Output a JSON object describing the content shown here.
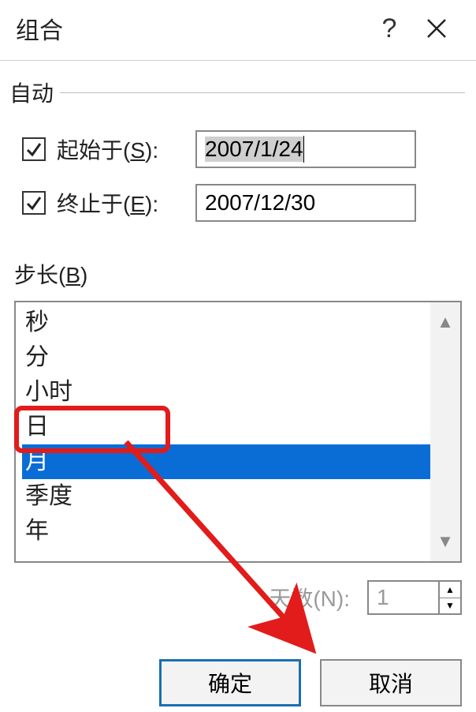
{
  "titlebar": {
    "title": "组合",
    "help": "?",
    "close_icon": "close-icon"
  },
  "auto": {
    "legend": "自动",
    "start": {
      "checked": true,
      "label_prefix": "起始于(",
      "label_hotkey": "S",
      "label_suffix": "):",
      "value": "2007/1/24"
    },
    "end": {
      "checked": true,
      "label_prefix": "终止于(",
      "label_hotkey": "E",
      "label_suffix": "):",
      "value": "2007/12/30"
    }
  },
  "step": {
    "label_prefix": "步长(",
    "label_hotkey": "B",
    "label_suffix": ")",
    "items": [
      "秒",
      "分",
      "小时",
      "日",
      "月",
      "季度",
      "年"
    ],
    "selected_index": 4
  },
  "days": {
    "label": "天数(N):",
    "value": "1"
  },
  "buttons": {
    "ok": "确定",
    "cancel": "取消"
  }
}
